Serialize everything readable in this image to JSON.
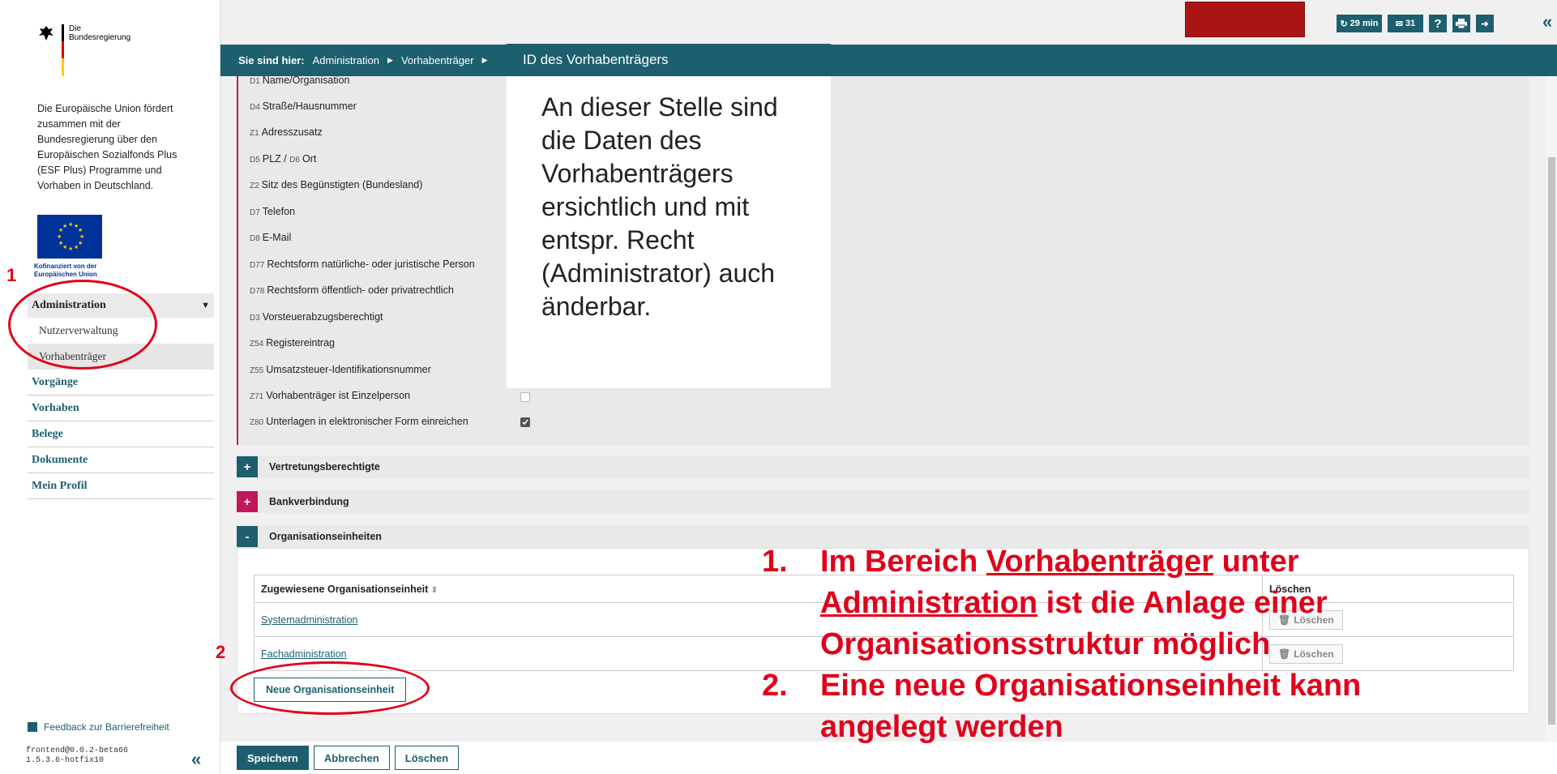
{
  "sidebar": {
    "logo_text_line1": "Die",
    "logo_text_line2": "Bundesregierung",
    "eu_text": "Die Europäische Union fördert zusammen mit der Bundesregierung über den Europäischen Sozialfonds Plus (ESF Plus) Programme und Vorhaben in Deutschland.",
    "eu_caption": "Kofinanziert von der Europäischen Union",
    "nav": {
      "admin_label": "Administration",
      "sub_items": [
        "Nutzerverwaltung",
        "Vorhabenträger"
      ],
      "items": [
        "Vorgänge",
        "Vorhaben",
        "Belege",
        "Dokumente",
        "Mein Profil"
      ]
    },
    "feedback": "Feedback zur Barrierefreiheit",
    "version_line1": "frontend@0.0.2-beta66",
    "version_line2": "1.5.3.6-hotfix10",
    "collapse": "«"
  },
  "topbar": {
    "timer": "29 min",
    "messages": "31",
    "help": "?",
    "collapse": "«"
  },
  "breadcrumb": {
    "label": "Sie sind hier:",
    "items": [
      "Administration",
      "Vorhabenträger"
    ]
  },
  "form_fields": [
    {
      "code": "D1",
      "label": "Name/Organisation"
    },
    {
      "code": "D4",
      "label": "Straße/Hausnummer"
    },
    {
      "code": "Z1",
      "label": "Adresszusatz"
    },
    {
      "code": "D5",
      "label": "PLZ /",
      "code2": "D6",
      "label2": "Ort"
    },
    {
      "code": "Z2",
      "label": "Sitz des Begünstigten (Bundesland)"
    },
    {
      "code": "D7",
      "label": "Telefon"
    },
    {
      "code": "D8",
      "label": "E-Mail"
    },
    {
      "code": "D77",
      "label": "Rechtsform natürliche- oder juristische Person"
    },
    {
      "code": "D78",
      "label": "Rechtsform öffentlich- oder privatrechtlich"
    },
    {
      "code": "D3",
      "label": "Vorsteuerabzugsberechtigt"
    },
    {
      "code": "Z54",
      "label": "Registereintrag"
    },
    {
      "code": "Z55",
      "label": "Umsatzsteuer-Identifikationsnummer"
    },
    {
      "code": "Z71",
      "label": "Vorhabenträger ist Einzelperson",
      "checked": false
    },
    {
      "code": "Z80",
      "label": "Unterlagen in elektronischer Form einreichen",
      "checked": true
    }
  ],
  "tooltip": {
    "title": "ID des Vorhabenträgers",
    "body": "An dieser Stelle sind die Daten des Vorhabenträgers ersichtlich und mit entspr. Recht (Administrator) auch änderbar."
  },
  "sections": {
    "vertretung": {
      "toggle": "+",
      "label": "Vertretungsberechtigte"
    },
    "bank": {
      "toggle": "+",
      "label": "Bankverbindung"
    },
    "org": {
      "toggle": "-",
      "label": "Organisationseinheiten"
    }
  },
  "org_table": {
    "col_unit": "Zugewiesene Organisationseinheit",
    "col_delete": "Löschen",
    "rows": [
      {
        "name": "Systemadministration",
        "delete": "Löschen"
      },
      {
        "name": "Fachadministration",
        "delete": "Löschen"
      }
    ],
    "new_button": "Neue Organisationseinheit"
  },
  "bottom_buttons": {
    "save": "Speichern",
    "cancel": "Abbrechen",
    "delete": "Löschen"
  },
  "annotations": {
    "marker1": "1",
    "marker2": "2",
    "step1_num": "1.",
    "step1_pre": "Im Bereich ",
    "step1_u1": "Vorhabenträger",
    "step1_mid": " unter",
    "step1_u2": "Administration",
    "step1_post": " ist die Anlage einer",
    "step1_line3": "Organisationsstruktur möglich",
    "step2_num": "2.",
    "step2_line1": "Eine neue Organisationseinheit kann",
    "step2_line2": "angelegt werden"
  },
  "colors": {
    "primary": "#1d5f6e",
    "accent_red": "#e0001b",
    "bank_toggle": "#c2185b",
    "redacted": "#ab1414"
  }
}
